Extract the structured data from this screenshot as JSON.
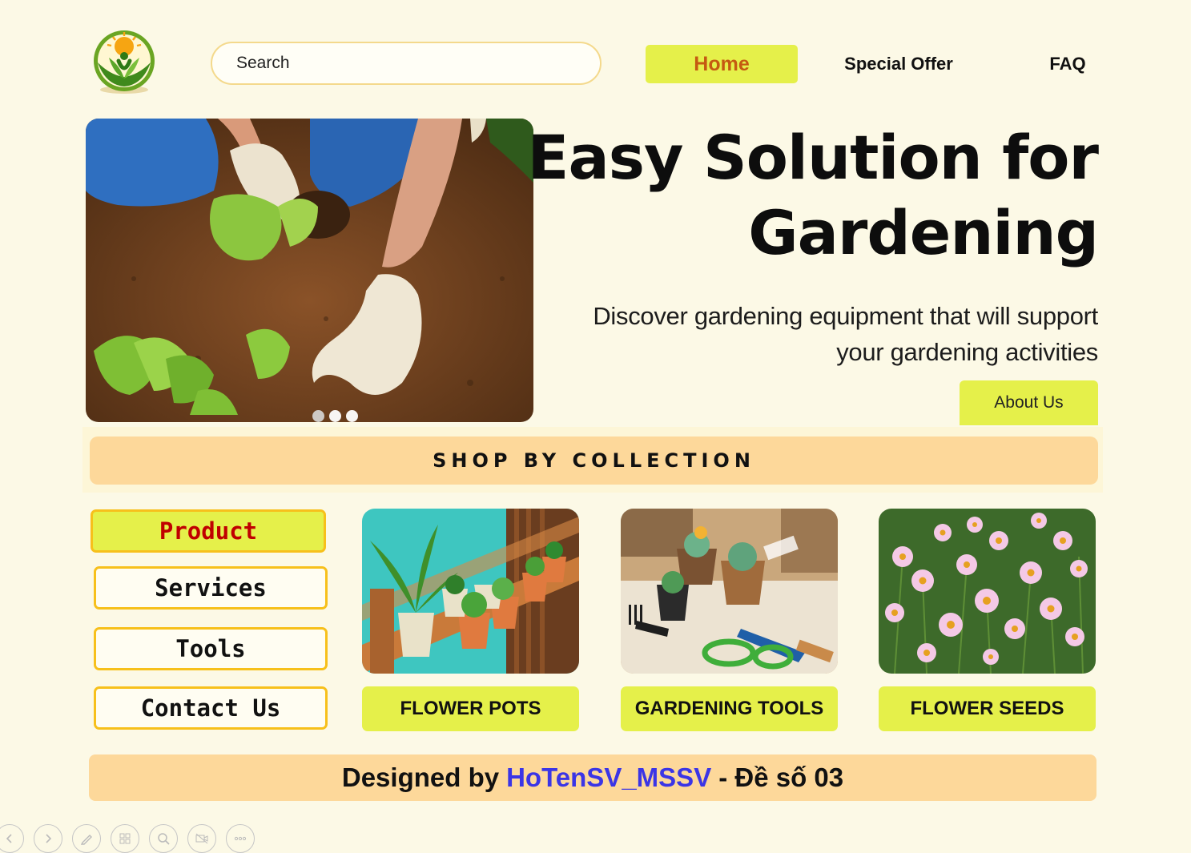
{
  "header": {
    "logo_icon": "gardening-logo-icon",
    "search_placeholder": "Search",
    "nav": [
      {
        "label": "Home",
        "active": true
      },
      {
        "label": "Special Offer",
        "active": false
      },
      {
        "label": "FAQ",
        "active": false
      }
    ]
  },
  "hero": {
    "title_line1": "Easy Solution for",
    "title_line2": "Gardening",
    "subtitle_line1": "Discover gardening equipment that will support",
    "subtitle_line2": "your gardening activities",
    "about_label": "About Us",
    "carousel_dots": 3
  },
  "collection": {
    "heading": "SHOP BY COLLECTION"
  },
  "sidebar": {
    "items": [
      {
        "label": "Product",
        "active": true
      },
      {
        "label": "Services",
        "active": false
      },
      {
        "label": "Tools",
        "active": false
      },
      {
        "label": "Contact Us",
        "active": false
      }
    ]
  },
  "cards": [
    {
      "label": "FLOWER POTS",
      "image": "potted-plants-on-shelf"
    },
    {
      "label": "GARDENING TOOLS",
      "image": "succulents-and-garden-tools"
    },
    {
      "label": "FLOWER SEEDS",
      "image": "pink-daisy-flowers"
    }
  ],
  "footer": {
    "prefix": "Designed by",
    "highlight": "HoTenSV_MSSV",
    "suffix": "- Đề số 03"
  },
  "colors": {
    "background": "#fcf9e6",
    "accent_lime": "#e5f04a",
    "accent_peach": "#fdd89a",
    "border_yellow": "#f7c01b",
    "home_text": "#c55a11",
    "product_text": "#c00000",
    "footer_highlight": "#3b35e6"
  },
  "slideshow_toolbar": [
    "previous-icon",
    "next-icon",
    "pen-icon",
    "slides-icon",
    "zoom-icon",
    "video-icon",
    "more-icon"
  ]
}
